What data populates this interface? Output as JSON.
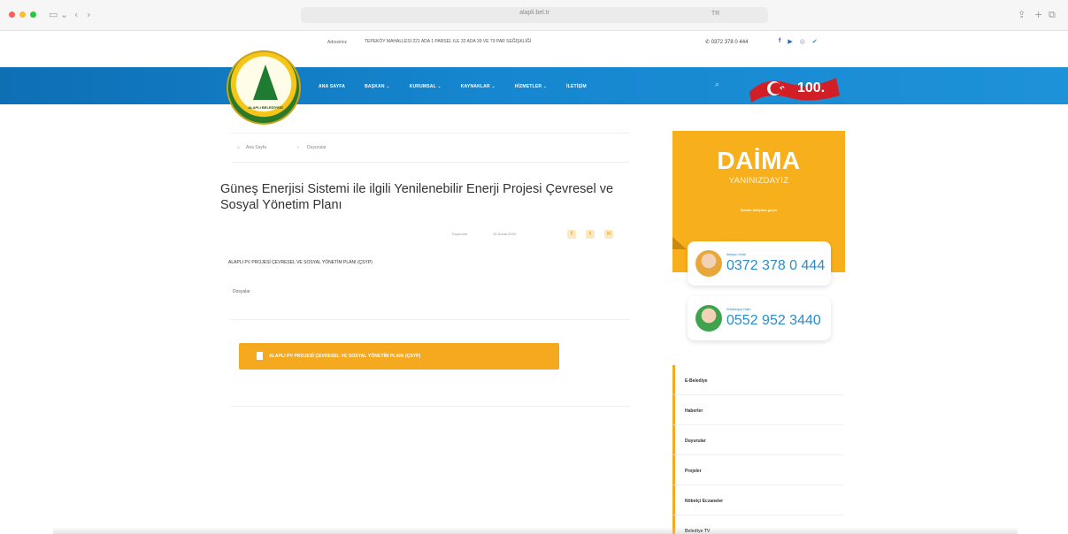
{
  "browser": {
    "url": "alapli.bel.tr",
    "tab_label": "TR",
    "nav_icons": [
      "sidebar-icon",
      "chevron-down-icon",
      "back-icon",
      "forward-icon"
    ],
    "right_icons": [
      "share-icon",
      "plus-icon",
      "tabs-icon"
    ]
  },
  "topbar": {
    "address_label": "Adresimiz",
    "address": "TEPEKÖY MAHALLESİ 221 ADA 1 PARSEL ILE 32 ADA 39 VE 79 PAR SEĞİŞKLİĞİ",
    "phone": "0372 378 0 444",
    "social": [
      "f",
      "▶",
      "◎",
      "✔"
    ]
  },
  "logo": {
    "text": "ALAPLI BELEDİYESİ"
  },
  "nav": {
    "items": [
      "ANA SAYFA",
      "BAŞKAN ⌄",
      "KURUMSAL ⌄",
      "KAYNAKLAR ⌄",
      "HİZMETLER ⌄",
      "İLETİŞİM"
    ],
    "search_icon": "search-icon",
    "badge": "100."
  },
  "breadcrumb": {
    "home": "Ana Sayfa",
    "sep": "›",
    "current": "Duyurular"
  },
  "article": {
    "title": "Güneş Enerjisi Sistemi ile ilgili Yenilenebilir Enerji Projesi Çevresel ve Sosyal Yönetim Planı",
    "category": "Duyurular",
    "date": "28 Şubat 2024",
    "share": [
      "f",
      "t",
      "✉"
    ],
    "subtitle": "ALAPLI PV PROJESİ ÇEVRESEL VE SOSYAL YÖNETİM PLANI (ÇSYP)",
    "docs_label": "Dosyalar",
    "document_button": "ALAPLI PV PROJESİ ÇEVRESEL VE SOSYAL YÖNETİM PLANI (ÇSYP)"
  },
  "sidebar": {
    "banner_title": "DAİMA",
    "banner_sub": "YANINIZDAYIZ",
    "banner_small": "Sizinle iletişime geçin",
    "cards": [
      {
        "label": "İletişim Hattı",
        "number": "0372 378 0 444"
      },
      {
        "label": "Whatsapp Hattı",
        "number": "0552 952 3440"
      }
    ],
    "menu": [
      "E-Belediye",
      "Haberler",
      "Duyurular",
      "Projeler",
      "Nöbetçi Eczaneler",
      "Belediye TV"
    ]
  },
  "colors": {
    "nav_blue": "#1586cf",
    "accent_orange": "#f5a91e",
    "card_blue": "#2a8dc9"
  }
}
